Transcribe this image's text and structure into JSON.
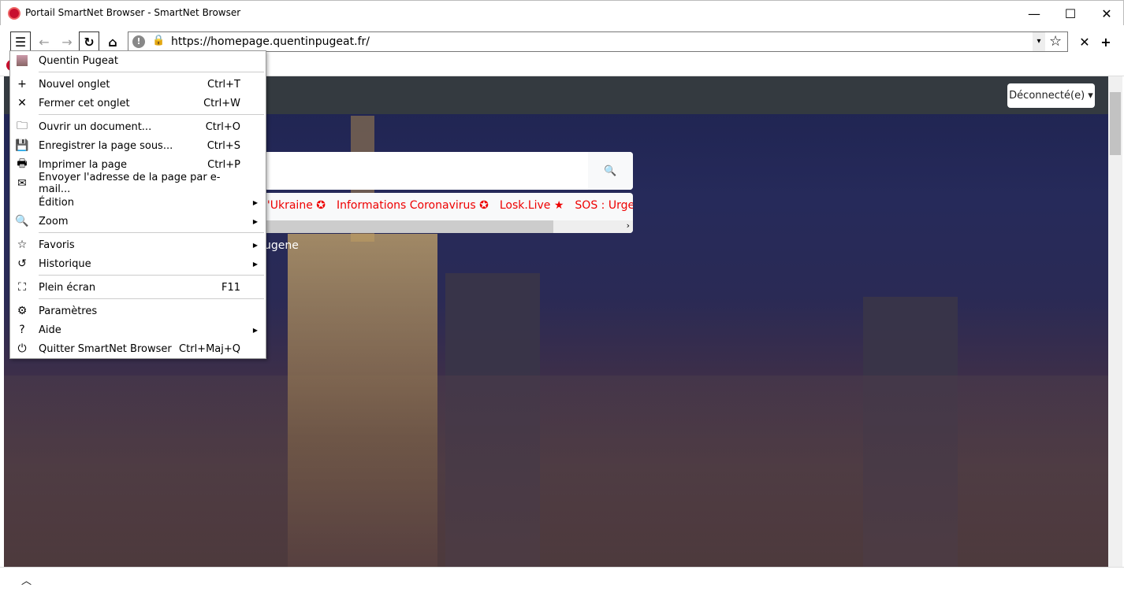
{
  "window": {
    "title": "Portail SmartNet Browser - SmartNet Browser",
    "minimize": "—",
    "maximize": "☐",
    "close": "✕"
  },
  "toolbar": {
    "menu_icon": "☰",
    "back_icon": "←",
    "forward_icon": "→",
    "reload_icon": "↻",
    "home_icon": "⌂",
    "url": "https://homepage.quentinpugeat.fr/",
    "warning_icon": "!",
    "lock_icon": "🔒",
    "dropdown_icon": "▾",
    "star_icon": "☆",
    "close_tab_icon": "✕",
    "new_tab_icon": "+"
  },
  "page": {
    "disconnected_label": "Déconnecté(e) ▾",
    "links": [
      "l'Ukraine ✪",
      "Informations Coronavirus ✪",
      "Losk.Live ★",
      "SOS : Urgen"
    ],
    "caption": "ugene",
    "search_icon": "🔍"
  },
  "menu": {
    "profile": "Quentin Pugeat",
    "items": [
      {
        "icon": "+",
        "label": "Nouvel onglet",
        "shortcut": "Ctrl+T"
      },
      {
        "icon": "✕",
        "label": "Fermer cet onglet",
        "shortcut": "Ctrl+W"
      },
      {
        "icon": "🗀",
        "label": "Ouvrir un document...",
        "shortcut": "Ctrl+O"
      },
      {
        "icon": "💾",
        "label": "Enregistrer la page sous...",
        "shortcut": "Ctrl+S"
      },
      {
        "icon": "🖶",
        "label": "Imprimer la page",
        "shortcut": "Ctrl+P"
      },
      {
        "icon": "✉",
        "label": "Envoyer l'adresse de la page par e-mail...",
        "shortcut": ""
      },
      {
        "icon": "",
        "label": "Édition",
        "shortcut": "",
        "submenu": true
      },
      {
        "icon": "🔍",
        "label": "Zoom",
        "shortcut": "",
        "submenu": true
      },
      {
        "icon": "☆",
        "label": "Favoris",
        "shortcut": "",
        "submenu": true
      },
      {
        "icon": "↺",
        "label": "Historique",
        "shortcut": "",
        "submenu": true
      },
      {
        "icon": "⛶",
        "label": "Plein écran",
        "shortcut": "F11"
      },
      {
        "icon": "⚙",
        "label": "Paramètres",
        "shortcut": ""
      },
      {
        "icon": "?",
        "label": "Aide",
        "shortcut": "",
        "submenu": true
      },
      {
        "icon": "⏻",
        "label": "Quitter SmartNet Browser",
        "shortcut": "Ctrl+Maj+Q"
      }
    ],
    "submenu_arrow": "▶"
  },
  "bottom": {
    "up_icon": "︿"
  }
}
